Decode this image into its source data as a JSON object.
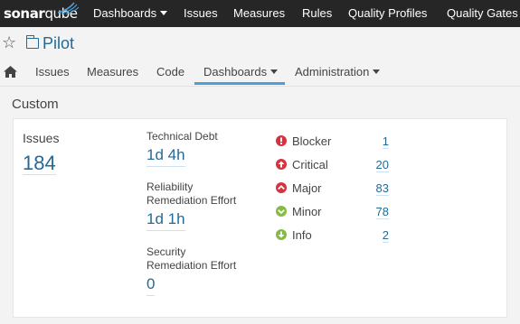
{
  "topbar": {
    "logo": {
      "sonar": "sonar",
      "qube": "qube"
    },
    "items": [
      {
        "label": "Dashboards",
        "dropdown": true
      },
      {
        "label": "Issues"
      },
      {
        "label": "Measures"
      },
      {
        "label": "Rules"
      },
      {
        "label": "Quality Profiles"
      },
      {
        "label": "Quality Gates"
      }
    ]
  },
  "project": {
    "name": "Pilot",
    "nav": [
      {
        "label": "Issues"
      },
      {
        "label": "Measures"
      },
      {
        "label": "Code"
      },
      {
        "label": "Dashboards",
        "dropdown": true,
        "active": true
      },
      {
        "label": "Administration",
        "dropdown": true
      }
    ]
  },
  "section": {
    "title": "Custom"
  },
  "widget": {
    "issues": {
      "label": "Issues",
      "value": "184"
    },
    "technical_debt": {
      "label": "Technical Debt",
      "value": "1d 4h"
    },
    "reliability": {
      "label_line1": "Reliability",
      "label_line2": "Remediation Effort",
      "value": "1d 1h"
    },
    "security": {
      "label_line1": "Security",
      "label_line2": "Remediation Effort",
      "value": "0"
    },
    "severities": [
      {
        "label": "Blocker",
        "count": "1",
        "icon": "blocker-icon",
        "color": "#d4333f"
      },
      {
        "label": "Critical",
        "count": "20",
        "icon": "critical-icon",
        "color": "#d4333f"
      },
      {
        "label": "Major",
        "count": "83",
        "icon": "major-icon",
        "color": "#d4333f"
      },
      {
        "label": "Minor",
        "count": "78",
        "icon": "minor-icon",
        "color": "#85bb43"
      },
      {
        "label": "Info",
        "count": "2",
        "icon": "info-icon",
        "color": "#85bb43"
      }
    ]
  },
  "colors": {
    "accent": "#236a97",
    "topbar": "#262626",
    "active_tab": "#4b9fd5"
  }
}
